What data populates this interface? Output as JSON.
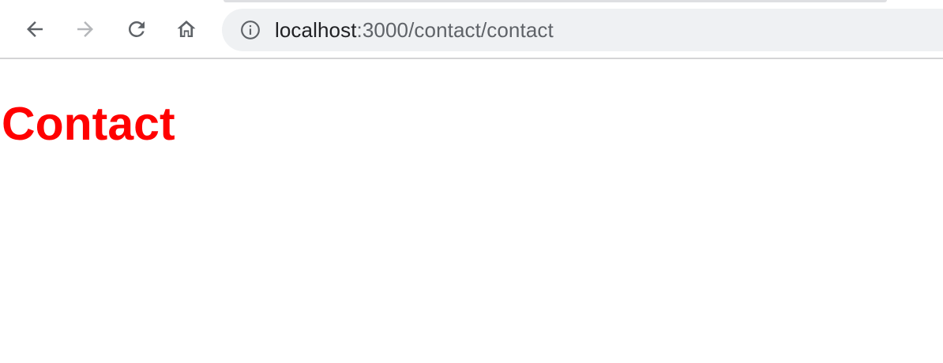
{
  "browser": {
    "nav": {
      "back_icon": "arrow-left-icon",
      "forward_icon": "arrow-right-icon",
      "reload_icon": "reload-icon",
      "home_icon": "home-icon"
    },
    "address_bar": {
      "info_icon": "info-icon",
      "url_host": "localhost",
      "url_rest": ":3000/contact/contact"
    }
  },
  "page": {
    "title": "Contact",
    "title_color": "#ff0000"
  },
  "colors": {
    "toolbar_bg": "#ffffff",
    "omnibox_bg": "#eff1f3",
    "icon_active": "#5f6368",
    "icon_disabled": "#b5b7ba"
  }
}
